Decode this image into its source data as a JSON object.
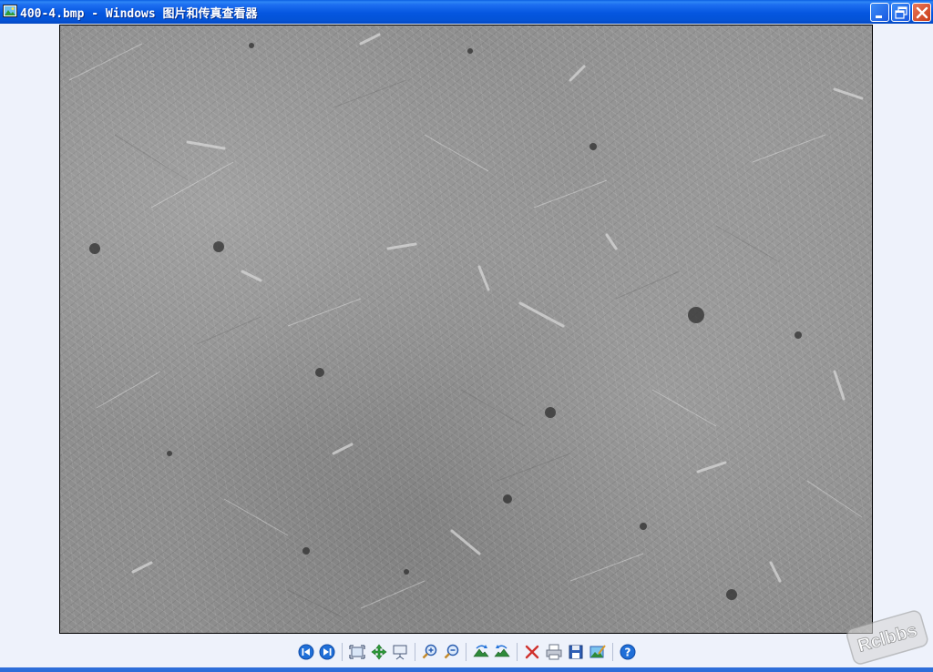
{
  "window": {
    "title": "400-4.bmp - Windows 图片和传真查看器",
    "icon": "image-viewer-app-icon"
  },
  "title_buttons": {
    "minimize": "minimize-icon",
    "restore": "restore-icon",
    "close": "close-icon"
  },
  "image": {
    "filename": "400-4.bmp",
    "content": "grayscale micrograph"
  },
  "toolbar": {
    "buttons": [
      {
        "icon": "previous-image-icon"
      },
      {
        "icon": "next-image-icon"
      },
      {
        "icon": "best-fit-icon"
      },
      {
        "icon": "actual-size-icon"
      },
      {
        "icon": "slideshow-icon"
      },
      {
        "icon": "zoom-in-icon"
      },
      {
        "icon": "zoom-out-icon"
      },
      {
        "icon": "rotate-clockwise-icon"
      },
      {
        "icon": "rotate-counterclockwise-icon"
      },
      {
        "icon": "delete-icon"
      },
      {
        "icon": "print-icon"
      },
      {
        "icon": "save-icon"
      },
      {
        "icon": "edit-image-icon"
      },
      {
        "icon": "help-icon"
      }
    ]
  },
  "watermark": {
    "text": "Rclbbs"
  },
  "colors": {
    "titlebar": "#0556e0",
    "frame_background": "#eef2fb",
    "accent_blue": "#1f6fd8",
    "close_red": "#c83b17"
  }
}
